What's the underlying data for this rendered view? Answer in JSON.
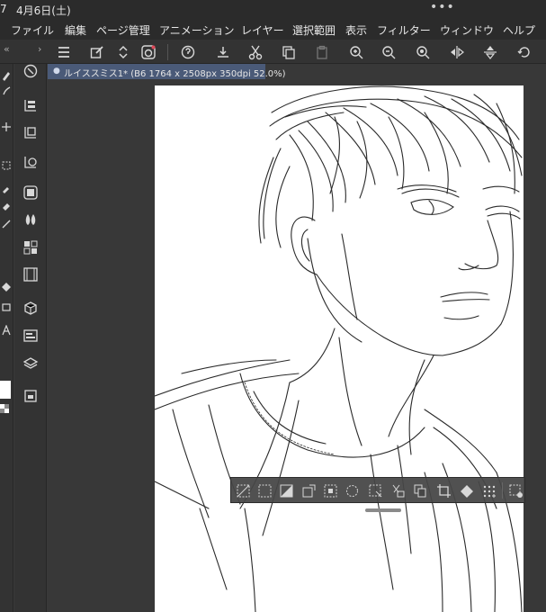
{
  "status_bar": {
    "time": "7",
    "date": "4月6日(土)",
    "more": "•••"
  },
  "menu": [
    "ファイル",
    "編集",
    "ページ管理",
    "アニメーション",
    "レイヤー",
    "選択範囲",
    "表示",
    "フィルター",
    "ウィンドウ",
    "ヘルプ"
  ],
  "toolbar": {
    "collapse_left": "«",
    "expand_right": "›",
    "icons": [
      "menu-icon",
      "edit-icon",
      "scroll-icon",
      "companion-icon",
      "quick-access-icon",
      "transfer-icon",
      "cut-icon",
      "copy-icon",
      "paste-icon",
      "zoom-in-icon",
      "zoom-out-icon",
      "fit-view-icon",
      "flip-horizontal-icon",
      "flip-vertical-icon",
      "rotate-icon"
    ]
  },
  "document_tab": {
    "title": "ルイススミス1* (B6 1764 x 2508px 350dpi 52.0%)"
  },
  "left_tools": [
    "zoom-tool-icon",
    "layer-move-icon",
    "layer-property-icon",
    "layer-search-icon",
    "color-wheel-icon",
    "color-set-icon",
    "intermediate-color-icon",
    "animation-timeline-icon",
    "3d-object-icon",
    "navigator-icon",
    "layers-icon",
    "history-icon"
  ],
  "selection_bar": {
    "icons": [
      "deselect-icon",
      "invert-selection-icon",
      "fill-selection-icon",
      "expand-selection-icon",
      "shrink-selection-icon",
      "reselect-icon",
      "select-layer-icon",
      "cut-paste-icon",
      "copy-paste-icon",
      "crop-icon",
      "fill-icon",
      "tone-icon",
      "selection-settings-icon"
    ]
  },
  "colors": {
    "ui_dark": "#2b2b2b",
    "ui_panel": "#333333",
    "canvas_bg": "#383838",
    "tab_active": "#4a5a78",
    "paper": "#ffffff",
    "icon": "#d8d8d8"
  }
}
